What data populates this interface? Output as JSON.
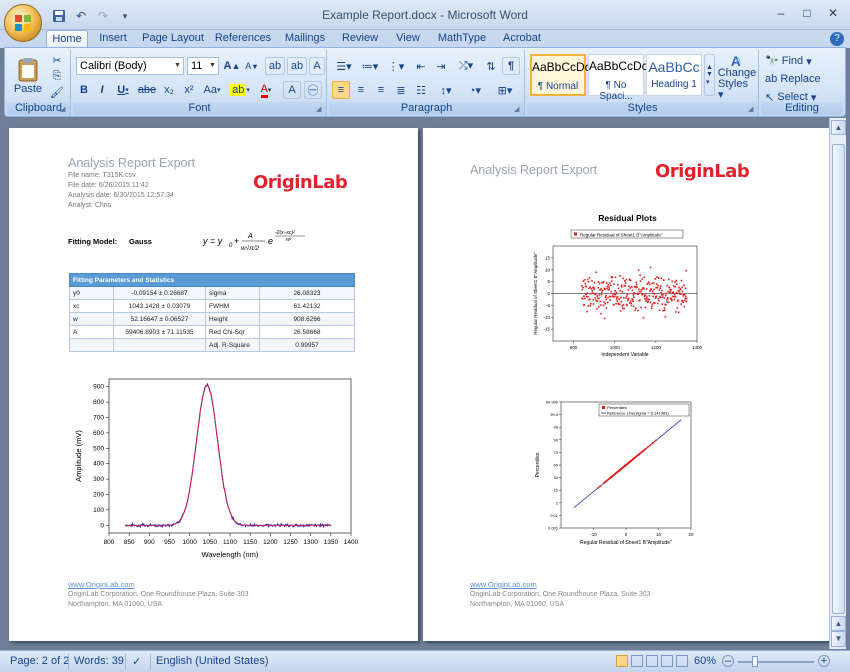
{
  "window": {
    "title": "Example Report.docx - Microsoft Word",
    "controls": {
      "minimize": "–",
      "maximize": "□",
      "close": "✕"
    }
  },
  "quick_access": {
    "save_icon": "floppy-icon",
    "undo": "↶",
    "redo": "↷",
    "customize": "▾"
  },
  "tabs": [
    {
      "label": "Home",
      "active": true
    },
    {
      "label": "Insert"
    },
    {
      "label": "Page Layout"
    },
    {
      "label": "References"
    },
    {
      "label": "Mailings"
    },
    {
      "label": "Review"
    },
    {
      "label": "View"
    },
    {
      "label": "MathType"
    },
    {
      "label": "Acrobat"
    }
  ],
  "ribbon": {
    "clipboard": {
      "label": "Clipboard",
      "paste": "Paste"
    },
    "font": {
      "label": "Font",
      "font_name": "Calibri (Body)",
      "font_size": "11",
      "bold": "B",
      "italic": "I",
      "underline": "U",
      "strike": "abe",
      "subscript": "x₂",
      "superscript": "x²",
      "change_case": "Aa",
      "grow": "A",
      "shrink": "A",
      "clear": "A"
    },
    "paragraph": {
      "label": "Paragraph",
      "pilcrow": "¶"
    },
    "styles": {
      "label": "Styles",
      "tiles": [
        {
          "sample": "AaBbCcDc",
          "name": "¶ Normal"
        },
        {
          "sample": "AaBbCcDc",
          "name": "¶ No Spaci..."
        },
        {
          "sample": "AaBbCc",
          "name": "Heading 1"
        }
      ],
      "change_styles": "Change Styles",
      "change_styles_line1": "Change",
      "change_styles_line2": "Styles"
    },
    "editing": {
      "label": "Editing",
      "find": "Find",
      "replace": "Replace",
      "select": "Select"
    }
  },
  "page1": {
    "header_title": "Analysis Report Export",
    "meta": [
      "File name:  T315K.csv",
      "File date:  6/26/2015 11:42",
      "Analysis date:  6/30/2015 12:57:34",
      "Analyst:  Chris"
    ],
    "logo": "OriginLab",
    "fitting_model_label": "Fitting Model:",
    "fitting_model_value": "Gauss",
    "formula_lhs": "y = y",
    "formula_sub": "0",
    "formula_rest": " + ",
    "table_header": "Fitting Parameters and Statistics",
    "table_rows": [
      [
        "y0",
        "-0.09154 ± 0.26687",
        "sigma",
        "26.08323"
      ],
      [
        "xc",
        "1043.1428 ± 0.03079",
        "FWHM",
        "61.42132"
      ],
      [
        "w",
        "52.16647 ± 0.06527",
        "Height",
        "908.6266"
      ],
      [
        "A",
        "59406.8903 ± 71.11535",
        "Red Chi-Sqr",
        "26.58668"
      ],
      [
        "",
        "",
        "Adj. R-Square",
        "0.99957"
      ]
    ],
    "footer_link": "www.OriginLab.com",
    "footer_line1": "OriginLab Corporation, One Roundhouse Plaza, Suite 303",
    "footer_line2": "Northampton, MA 01060, USA"
  },
  "page2": {
    "header_title": "Analysis Report Export",
    "logo": "OriginLab",
    "section_title": "Residual Plots",
    "footer_link": "www.OriginLab.com",
    "footer_line1": "OriginLab Corporation, One Roundhouse Plaza, Suite 303",
    "footer_line2": "Northampton, MA 01060, USA"
  },
  "chart_data": [
    {
      "type": "line",
      "title": "",
      "xlabel": "Wavelength (nm)",
      "ylabel": "Amplitude (mV)",
      "xlim": [
        800,
        1400
      ],
      "ylim": [
        -50,
        950
      ],
      "xticks": [
        800,
        850,
        900,
        950,
        1000,
        1050,
        1100,
        1150,
        1200,
        1250,
        1300,
        1350,
        1400
      ],
      "yticks": [
        0,
        100,
        200,
        300,
        400,
        500,
        600,
        700,
        800,
        900
      ],
      "series": [
        {
          "model": "gauss",
          "y0": -0.09154,
          "xc": 1043.1428,
          "w": 52.16647,
          "A": 59406.8903,
          "x_range": [
            840,
            1350
          ]
        }
      ]
    },
    {
      "type": "scatter",
      "title": "",
      "xlabel": "Independent Variable",
      "ylabel": "Regular Residual of Sheet1 B\"Amplitude\"",
      "legend": [
        "Regular Residual of Sheet1 B\"Amplitude\""
      ],
      "xlim": [
        700,
        1400
      ],
      "ylim": [
        -20,
        20
      ],
      "xticks": [
        800,
        1000,
        1200,
        1400
      ],
      "yticks": [
        -15,
        -10,
        -5,
        0,
        5,
        10,
        15
      ],
      "x_range": [
        840,
        1350
      ],
      "residual_spread": 6
    },
    {
      "type": "scatter",
      "title": "",
      "xlabel": "Regular Residual of Sheet1 B\"Amplitude\"",
      "ylabel": "Percentiles",
      "legend": [
        "Percentiles",
        "Reference Line(sigma = 5.141083)"
      ],
      "xlim": [
        -20,
        20
      ],
      "xticks": [
        -10,
        0,
        10,
        20
      ],
      "ytick_labels": [
        "0.001",
        "0.01",
        "1",
        "10",
        "30",
        "50",
        "70",
        "90",
        "99",
        "99.9",
        "99.999"
      ],
      "sigma": 5.141083
    }
  ],
  "status": {
    "page": "Page: 2 of 2",
    "words": "Words: 39",
    "language": "English (United States)",
    "zoom": "60%"
  }
}
